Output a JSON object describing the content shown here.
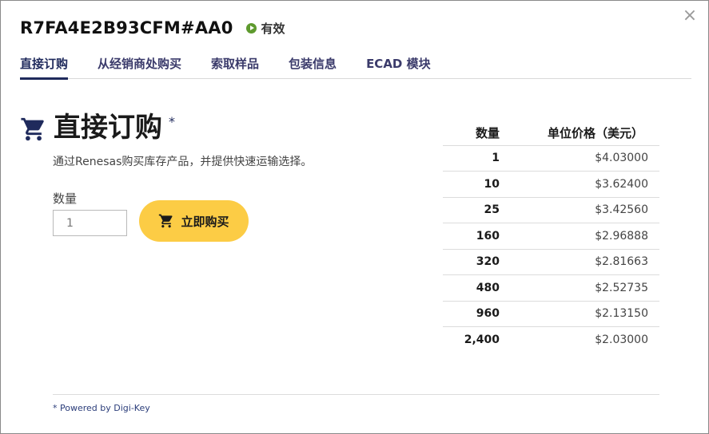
{
  "header": {
    "part_number": "R7FA4E2B93CFM#AA0",
    "status": "有效",
    "close_symbol": "×"
  },
  "tabs": [
    {
      "label": "直接订购",
      "active": true
    },
    {
      "label": "从经销商处购买",
      "active": false
    },
    {
      "label": "索取样品",
      "active": false
    },
    {
      "label": "包装信息",
      "active": false
    },
    {
      "label": "ECAD 模块",
      "active": false
    }
  ],
  "section": {
    "title": "直接订购",
    "asterisk": "*",
    "description": "通过Renesas购买库存产品，并提供快速运输选择。",
    "quantity_label": "数量",
    "quantity_value": "1",
    "buy_button": "立即购买"
  },
  "price_table": {
    "headers": {
      "quantity": "数量",
      "unit_price": "单位价格（美元）"
    },
    "rows": [
      {
        "quantity": "1",
        "price": "$4.03000"
      },
      {
        "quantity": "10",
        "price": "$3.62400"
      },
      {
        "quantity": "25",
        "price": "$3.42560"
      },
      {
        "quantity": "160",
        "price": "$2.96888"
      },
      {
        "quantity": "320",
        "price": "$2.81663"
      },
      {
        "quantity": "480",
        "price": "$2.52735"
      },
      {
        "quantity": "960",
        "price": "$2.13150"
      },
      {
        "quantity": "2,400",
        "price": "$2.03000"
      }
    ]
  },
  "footer": {
    "powered_by": "* Powered by Digi-Key"
  },
  "colors": {
    "brand_navy": "#1f2a5c",
    "status_green": "#5e9a2e",
    "buy_yellow": "#fccc45"
  },
  "icons": {
    "cart": "shopping-cart-icon",
    "close": "close-icon",
    "status": "play-circle-icon"
  }
}
